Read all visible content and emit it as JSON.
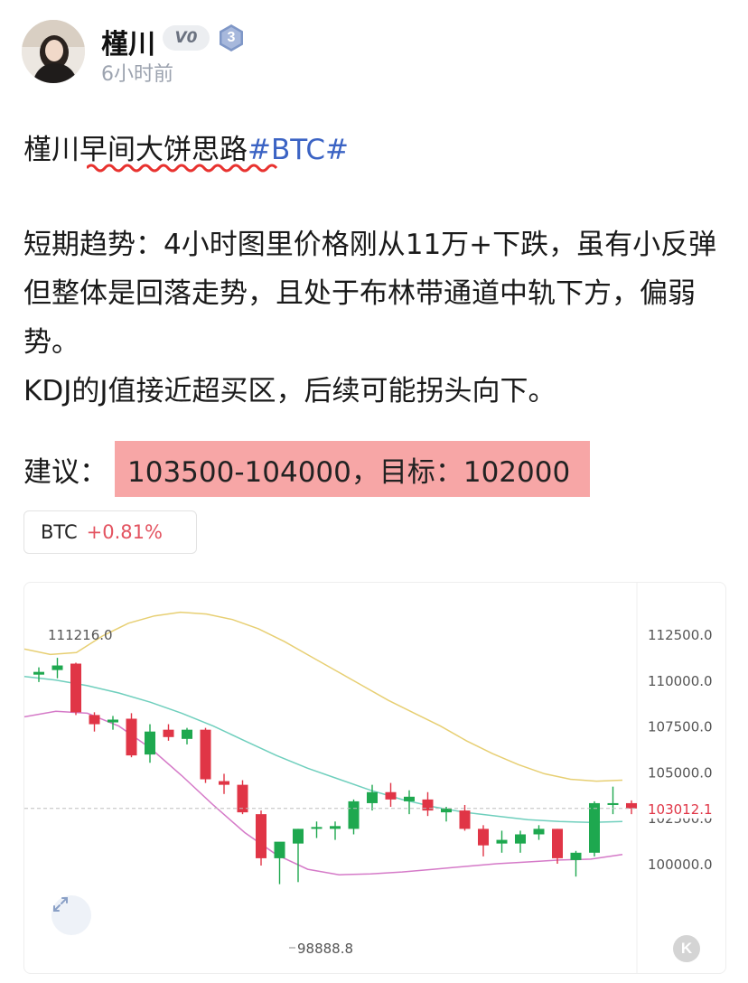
{
  "author": {
    "name": "槿川",
    "verify_badge": "V0",
    "level": "3",
    "time": "6小时前",
    "avatar_icon": "avatar-photo"
  },
  "post": {
    "title_prefix": "槿川早间大饼思路",
    "hashtag": "#BTC#",
    "paragraph1": "短期趋势：4小时图里价格刚从11万+下跌，虽有小反弹但整体是回落走势，且处于布林带通道中轨下方，偏弱势。",
    "paragraph2": "KDJ的J值接近超买区，后续可能拐头向下。",
    "suggest_label": "建议：",
    "suggest_value": "103500-104000，目标：102000",
    "highlight_color": "#f7a6a6"
  },
  "ticker": {
    "symbol": "BTC",
    "change": "+0.81%",
    "change_color": "#e35360"
  },
  "chart_data": {
    "type": "candlestick",
    "y_ticks": [
      {
        "value": 112500,
        "label": "112500.0"
      },
      {
        "value": 110000,
        "label": "110000.0"
      },
      {
        "value": 107500,
        "label": "107500.0"
      },
      {
        "value": 105000,
        "label": "105000.0"
      },
      {
        "value": 102500,
        "label": "102500.0"
      },
      {
        "value": 100000,
        "label": "100000.0"
      }
    ],
    "ylim": [
      99000,
      113800
    ],
    "current_price": 103012.1,
    "current_price_label": "103012.1",
    "high_label": "111216.0",
    "low_label": "98888.8",
    "up_color": "#1ea84f",
    "down_color": "#e03546",
    "band_upper_color": "#e7cf73",
    "band_mid_color": "#6fcfbd",
    "band_lower_color": "#d57ac8",
    "candles": [
      {
        "o": 110300,
        "h": 110700,
        "l": 109900,
        "c": 110450
      },
      {
        "o": 110550,
        "h": 111216,
        "l": 110100,
        "c": 110800
      },
      {
        "o": 110900,
        "h": 110950,
        "l": 108100,
        "c": 108250
      },
      {
        "o": 108100,
        "h": 108250,
        "l": 107200,
        "c": 107600
      },
      {
        "o": 107700,
        "h": 108050,
        "l": 107300,
        "c": 107850
      },
      {
        "o": 107900,
        "h": 108200,
        "l": 105800,
        "c": 105900
      },
      {
        "o": 105950,
        "h": 107600,
        "l": 105500,
        "c": 107200
      },
      {
        "o": 107300,
        "h": 107600,
        "l": 106700,
        "c": 106900
      },
      {
        "o": 106800,
        "h": 107400,
        "l": 106500,
        "c": 107300
      },
      {
        "o": 107300,
        "h": 107400,
        "l": 104400,
        "c": 104600
      },
      {
        "o": 104500,
        "h": 104900,
        "l": 103800,
        "c": 104300
      },
      {
        "o": 104300,
        "h": 104550,
        "l": 102700,
        "c": 102800
      },
      {
        "o": 102700,
        "h": 102900,
        "l": 99900,
        "c": 100300
      },
      {
        "o": 100300,
        "h": 101100,
        "l": 98888.8,
        "c": 101200
      },
      {
        "o": 101100,
        "h": 101900,
        "l": 99000,
        "c": 101900
      },
      {
        "o": 101900,
        "h": 102300,
        "l": 101400,
        "c": 102000
      },
      {
        "o": 101900,
        "h": 102300,
        "l": 101300,
        "c": 102050
      },
      {
        "o": 101900,
        "h": 103500,
        "l": 101600,
        "c": 103400
      },
      {
        "o": 103300,
        "h": 104300,
        "l": 102900,
        "c": 103900
      },
      {
        "o": 103900,
        "h": 104400,
        "l": 103100,
        "c": 103500
      },
      {
        "o": 103400,
        "h": 104000,
        "l": 102700,
        "c": 103650
      },
      {
        "o": 103500,
        "h": 103900,
        "l": 102600,
        "c": 102900
      },
      {
        "o": 102800,
        "h": 103100,
        "l": 102300,
        "c": 103000
      },
      {
        "o": 102900,
        "h": 103200,
        "l": 101800,
        "c": 101900
      },
      {
        "o": 101900,
        "h": 102100,
        "l": 100400,
        "c": 101000
      },
      {
        "o": 101100,
        "h": 101800,
        "l": 100600,
        "c": 101300
      },
      {
        "o": 101100,
        "h": 101800,
        "l": 100600,
        "c": 101600
      },
      {
        "o": 101600,
        "h": 102100,
        "l": 101300,
        "c": 101900
      },
      {
        "o": 101900,
        "h": 101900,
        "l": 100000,
        "c": 100300
      },
      {
        "o": 100200,
        "h": 100700,
        "l": 99300,
        "c": 100600
      },
      {
        "o": 100600,
        "h": 103400,
        "l": 100400,
        "c": 103300
      },
      {
        "o": 103200,
        "h": 104200,
        "l": 102700,
        "c": 103300
      },
      {
        "o": 103300,
        "h": 103450,
        "l": 102700,
        "c": 103012.1
      }
    ],
    "band_upper": [
      111700,
      111400,
      111500,
      112400,
      113100,
      113500,
      113700,
      113600,
      113300,
      112800,
      112100,
      111300,
      110500,
      109700,
      108900,
      108200,
      107500,
      106700,
      106000,
      105400,
      104900,
      104600,
      104500,
      104550
    ],
    "band_mid": [
      110200,
      110000,
      109700,
      109300,
      108800,
      108200,
      107500,
      106700,
      105900,
      105200,
      104600,
      104000,
      103500,
      103100,
      102800,
      102600,
      102400,
      102300,
      102250,
      102300
    ],
    "band_lower": [
      108000,
      108300,
      108200,
      107500,
      106300,
      104800,
      103200,
      101700,
      100500,
      99700,
      99400,
      99450,
      99550,
      99700,
      99850,
      100000,
      100100,
      100200,
      100250,
      100500
    ]
  }
}
